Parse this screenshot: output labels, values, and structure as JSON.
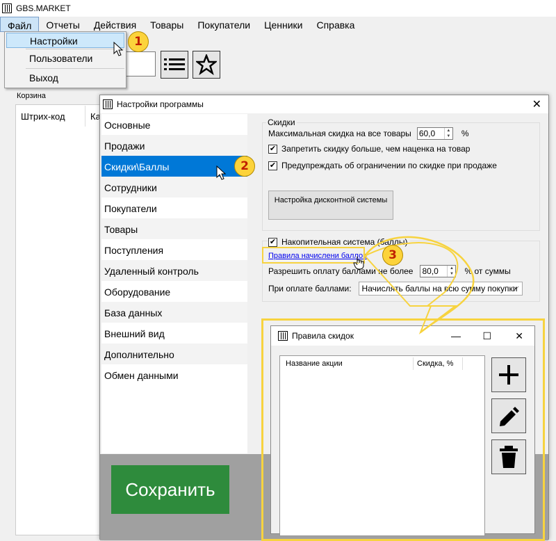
{
  "app": {
    "title": "GBS.MARKET"
  },
  "menu": [
    "Файл",
    "Отчеты",
    "Действия",
    "Товары",
    "Покупатели",
    "Ценники",
    "Справка"
  ],
  "file_menu": {
    "items": [
      "Настройки",
      "Пользователи",
      "Выход"
    ]
  },
  "cart": {
    "label": "Корзина",
    "columns": [
      "Штрих-код",
      "Ка"
    ]
  },
  "settings": {
    "title": "Настройки программы",
    "nav": [
      "Основные",
      "Продажи",
      "Скидки\\Баллы",
      "Сотрудники",
      "Покупатели",
      "Товары",
      "Поступления",
      "Удаленный контроль",
      "Оборудование",
      "База данных",
      "Внешний вид",
      "Дополнительно",
      "Обмен данными"
    ],
    "selected_index": 2,
    "discounts": {
      "group_label": "Скидки",
      "max_discount_label": "Максимальная скидка на все товары",
      "max_discount_value": "60,0",
      "percent_sign": "%",
      "forbid_label": "Запретить скидку больше, чем наценка на товар",
      "forbid_checked": true,
      "warn_label": "Предупреждать об ограничении по скидке при продаже",
      "warn_checked": true,
      "discount_button": "Настройка дисконтной системы"
    },
    "points": {
      "group_label": "Накопительная система (баллы)",
      "checked": true,
      "rules_link": "Правила начислени баллов",
      "allow_label": "Разрешить оплату баллами не более",
      "allow_value": "80,0",
      "allow_suffix": "% от суммы",
      "pay_label": "При оплате баллами:",
      "pay_value": "Начислять баллы на всю сумму покупки"
    },
    "save_button": "Сохранить"
  },
  "rules_dialog": {
    "title": "Правила скидок",
    "columns": [
      "Название акции",
      "Скидка, %"
    ]
  },
  "annotations": {
    "badges": [
      "1",
      "2",
      "3"
    ],
    "accent": "#f7d33f"
  }
}
